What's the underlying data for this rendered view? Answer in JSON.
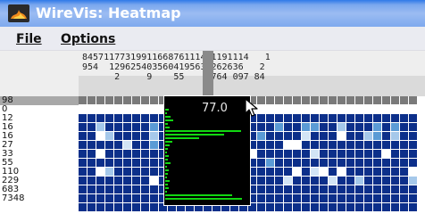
{
  "window": {
    "title": "WireVis: Heatmap"
  },
  "menu": {
    "file": "File",
    "options": "Options"
  },
  "column_header": {
    "digit_rows": [
      "8457117731991166876111411191114   1",
      "954  1296254035604195638262636   2",
      "      2     9    55     764 097 84  "
    ],
    "selected_column": 14
  },
  "row_labels": [
    "98",
    "0",
    "12",
    "16",
    "16",
    "27",
    "33",
    "55",
    "110",
    "229",
    "683",
    "7348"
  ],
  "highlighted_row": 0,
  "heatmap": {
    "colors": {
      "0": "#ffffff",
      "1": "#d2e4f5",
      "2": "#a5c8ea",
      "3": "#5b9bd5",
      "4": "#0c2f8a",
      "5": "#7a7a7a"
    },
    "rows": [
      "5555555555555555555555555555555555555555555",
      "0000000000000000000000000000000000000000000",
      "4444444444444444444444444444444444444444444",
      "4424444434444423444444344334424443434444213",
      "4402444424443424344434444144404423424444424",
      "4444414434444434444444400444444444444434321",
      "4404444444414434414044444414444444044414044",
      "4444444444444444444443444444444444444444444",
      "4402444444414444440444440410404444444044444",
      "4444444404444444444444414444144244444244444",
      "4444444444404444444444444444444444444444444",
      "4444444444444444444444444444444444444444444",
      "4444444444444444444444444444444444444444444"
    ]
  },
  "popup": {
    "value": "77.0",
    "bars": [
      4,
      2,
      6,
      10,
      3,
      5,
      90,
      70,
      40,
      8,
      5,
      3,
      2,
      4,
      3,
      6,
      2,
      4,
      3,
      2,
      5,
      3,
      4,
      2,
      80,
      92
    ]
  },
  "colors": {
    "titlebar": "#7aa7ee",
    "menubar": "#eaebf1",
    "bar": "#12d812",
    "popup_bg": "#000000"
  }
}
